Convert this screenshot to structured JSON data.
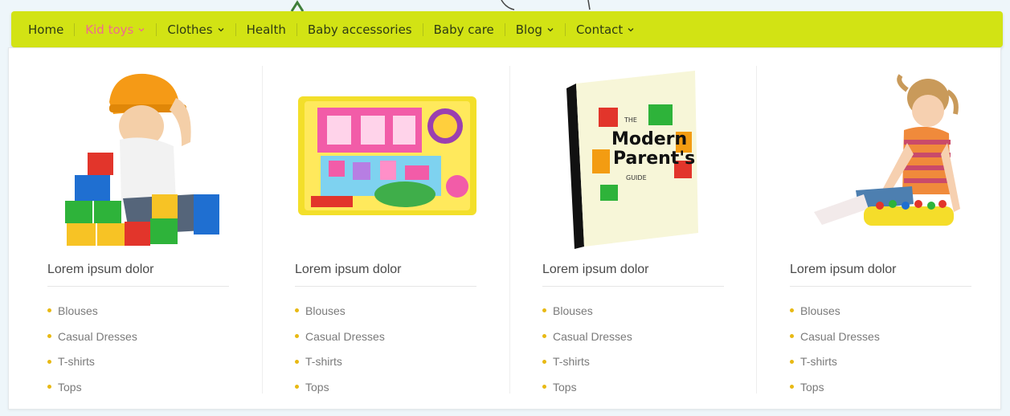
{
  "nav": {
    "items": [
      {
        "label": "Home",
        "active": false,
        "dropdown": false
      },
      {
        "label": "Kid toys",
        "active": true,
        "dropdown": true
      },
      {
        "label": "Clothes",
        "active": false,
        "dropdown": true
      },
      {
        "label": "Health",
        "active": false,
        "dropdown": false
      },
      {
        "label": "Baby accessories",
        "active": false,
        "dropdown": false
      },
      {
        "label": "Baby care",
        "active": false,
        "dropdown": false
      },
      {
        "label": "Blog",
        "active": false,
        "dropdown": true
      },
      {
        "label": "Contact",
        "active": false,
        "dropdown": true
      }
    ],
    "bg_color": "#d2e314",
    "active_color": "#f06a8f"
  },
  "columns": [
    {
      "image": "toddler-with-hardhat-and-blocks",
      "title": "Lorem ipsum dolor",
      "items": [
        "Blouses",
        "Casual Dresses",
        "T-shirts",
        "Tops"
      ]
    },
    {
      "image": "toy-playset-box",
      "title": "Lorem ipsum dolor",
      "items": [
        "Blouses",
        "Casual Dresses",
        "T-shirts",
        "Tops"
      ]
    },
    {
      "image": "modern-parents-guide-book",
      "title": "Lorem ipsum dolor",
      "items": [
        "Blouses",
        "Casual Dresses",
        "T-shirts",
        "Tops"
      ],
      "book": {
        "line1": "THE",
        "line2": "Modern",
        "line3": "Parent's",
        "line4": "GUIDE"
      }
    },
    {
      "image": "girl-playing-with-toy",
      "title": "Lorem ipsum dolor",
      "items": [
        "Blouses",
        "Casual Dresses",
        "T-shirts",
        "Tops"
      ]
    }
  ],
  "bullet_color": "#e8b914"
}
